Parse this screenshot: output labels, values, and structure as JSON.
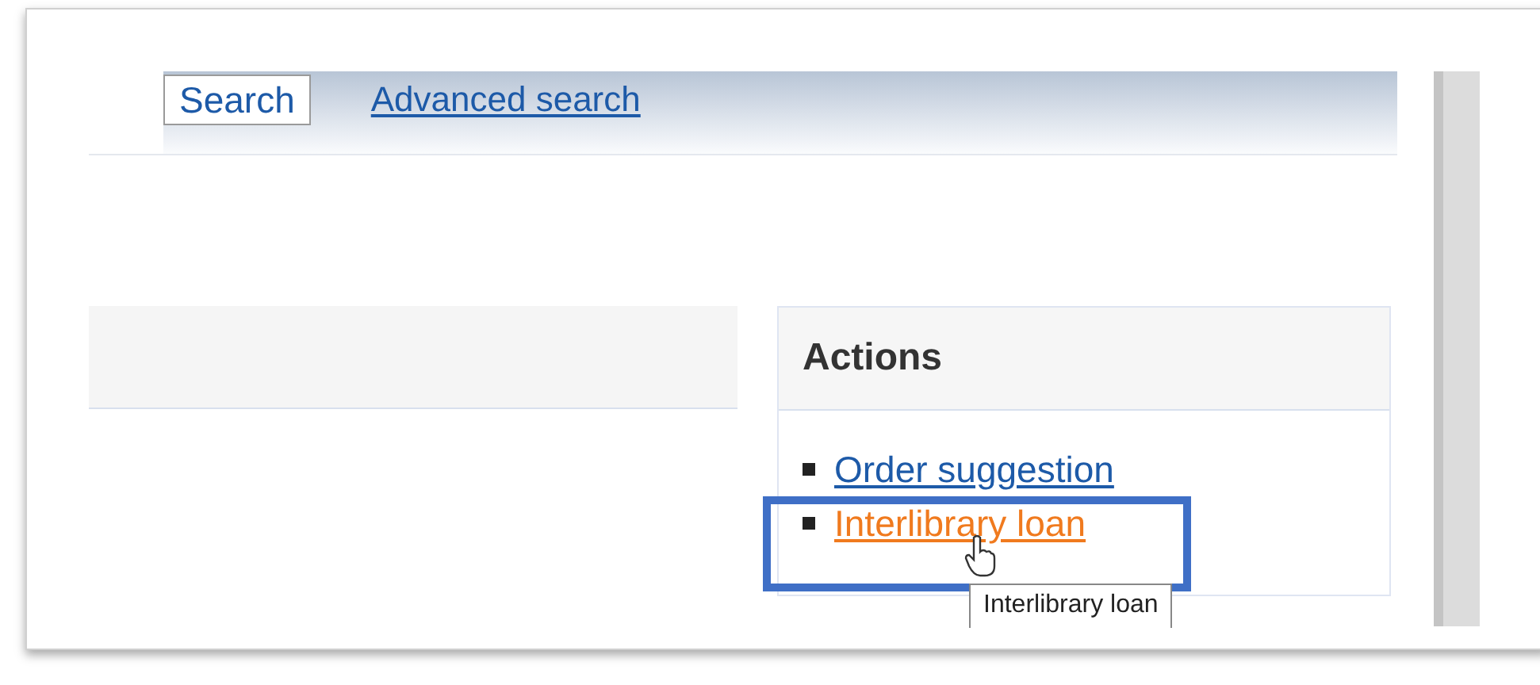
{
  "search_bar": {
    "search_button": "Search",
    "advanced_link": "Advanced search"
  },
  "actions": {
    "title": "Actions",
    "items": [
      {
        "label": "Order suggestion",
        "hovered": false
      },
      {
        "label": "Interlibrary loan",
        "hovered": true
      }
    ]
  },
  "tooltip": "Interlibrary loan"
}
